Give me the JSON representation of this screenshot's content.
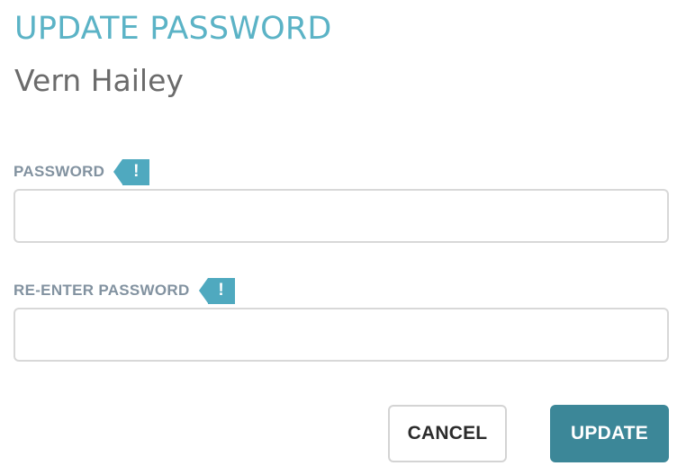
{
  "dialog": {
    "title": "UPDATE PASSWORD",
    "user_name": "Vern Hailey"
  },
  "fields": {
    "password": {
      "label": "PASSWORD",
      "value": "",
      "alert_glyph": "!",
      "alert_icon": "exclamation-tag-icon"
    },
    "reenter_password": {
      "label": "RE-ENTER PASSWORD",
      "value": "",
      "alert_glyph": "!",
      "alert_icon": "exclamation-tag-icon"
    }
  },
  "actions": {
    "cancel_label": "CANCEL",
    "update_label": "UPDATE"
  },
  "colors": {
    "title": "#5bb3c6",
    "subtitle": "#6b6b6b",
    "label": "#8292a0",
    "alert_tag": "#4fa9bf",
    "input_border": "#d8d8d8",
    "primary_button": "#3c8798"
  }
}
